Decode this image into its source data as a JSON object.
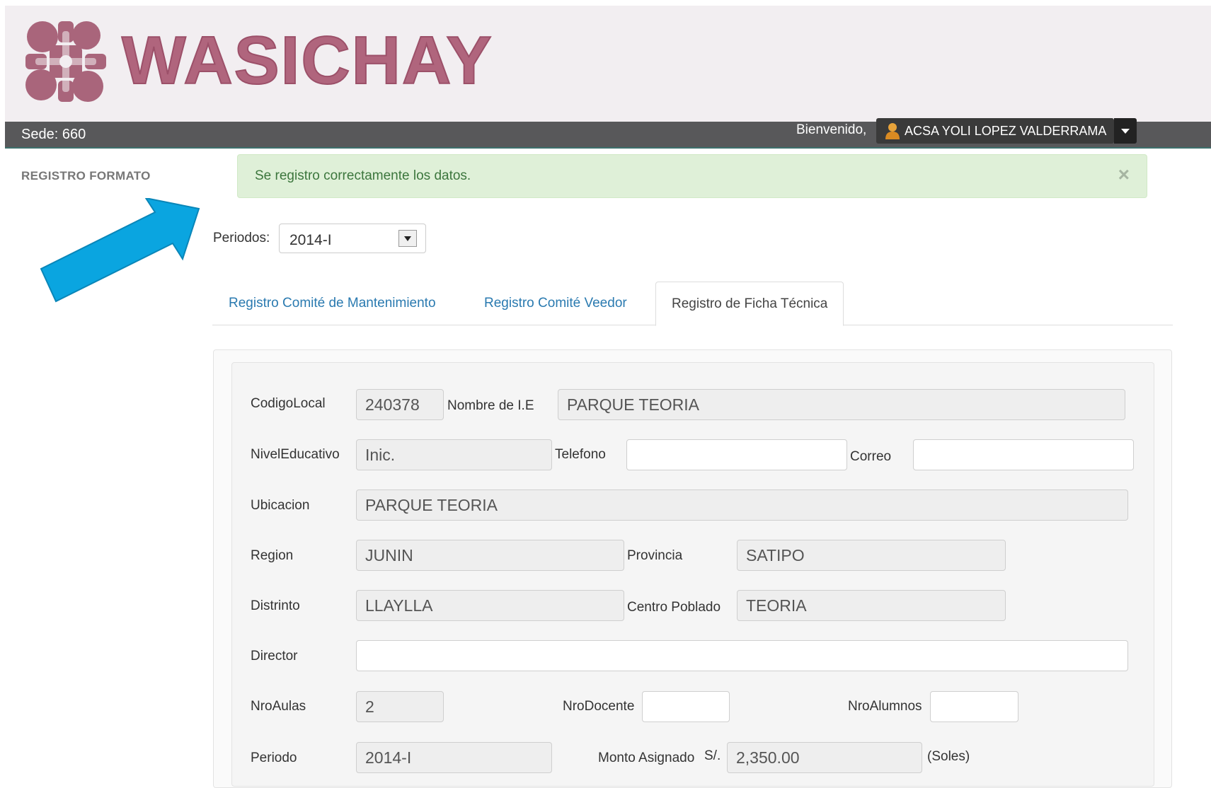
{
  "header": {
    "brand": "WASICHAY",
    "logo_icon": "puzzle-flower-logo",
    "sede": "Sede: 660",
    "welcome": "Bienvenido,",
    "user_name": "ACSA YOLI LOPEZ VALDERRAMA",
    "user_icon": "user-icon",
    "brand_color": "#b0657d"
  },
  "sidebar": {
    "title": "REGISTRO FORMATO"
  },
  "alert": {
    "message": "Se registro correctamente los datos.",
    "close": "×",
    "color": "#dff0d8"
  },
  "annotation": {
    "arrow_color": "#0aa5e0"
  },
  "periodos": {
    "label": "Periodos:",
    "value": "2014-I"
  },
  "tabs": [
    {
      "label": "Registro Comité de Mantenimiento",
      "active": false
    },
    {
      "label": "Registro Comité Veedor",
      "active": false
    },
    {
      "label": "Registro de Ficha Técnica",
      "active": true
    }
  ],
  "form": {
    "codigo_local": {
      "label": "CodigoLocal",
      "value": "240378"
    },
    "nombre_ie": {
      "label": "Nombre de I.E",
      "value": "PARQUE TEORIA"
    },
    "nivel_educativo": {
      "label": "NivelEducativo",
      "value": "Inic."
    },
    "telefono": {
      "label": "Telefono",
      "value": ""
    },
    "correo": {
      "label": "Correo",
      "value": ""
    },
    "ubicacion": {
      "label": "Ubicacion",
      "value": "PARQUE TEORIA"
    },
    "region": {
      "label": "Region",
      "value": "JUNIN"
    },
    "provincia": {
      "label": "Provincia",
      "value": "SATIPO"
    },
    "distrito": {
      "label": "Distrinto",
      "value": "LLAYLLA"
    },
    "centro_poblado": {
      "label": "Centro Poblado",
      "value": "TEORIA"
    },
    "director": {
      "label": "Director",
      "value": ""
    },
    "nro_aulas": {
      "label": "NroAulas",
      "value": "2"
    },
    "nro_docente": {
      "label": "NroDocente",
      "value": ""
    },
    "nro_alumnos": {
      "label": "NroAlumnos",
      "value": ""
    },
    "periodo": {
      "label": "Periodo",
      "value": "2014-I"
    },
    "monto_asignado": {
      "label": "Monto Asignado",
      "currency": "S/.",
      "value": "2,350.00",
      "unit": "(Soles)"
    }
  }
}
